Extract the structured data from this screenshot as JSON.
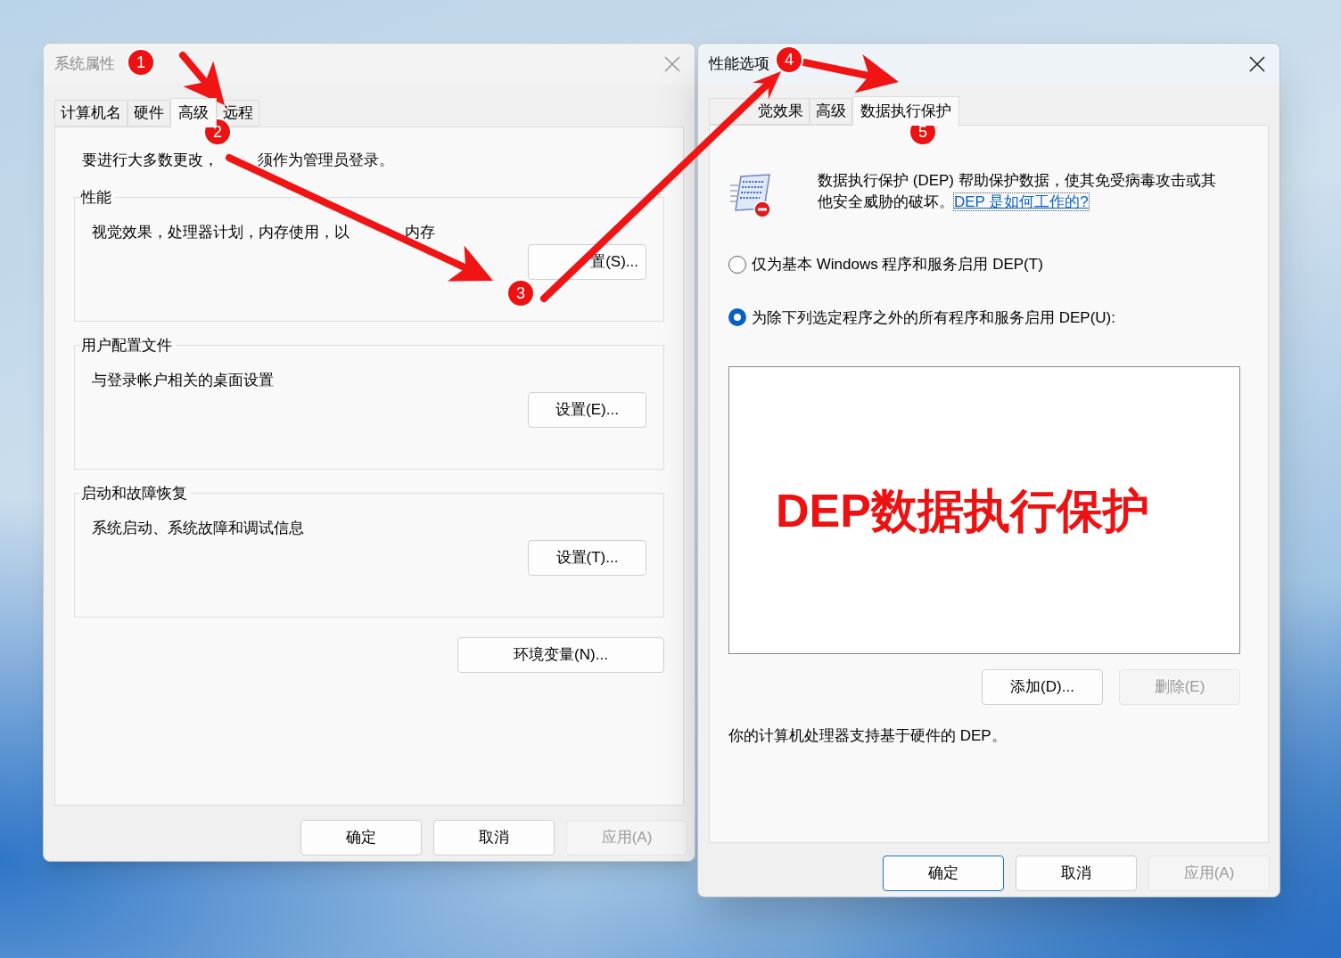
{
  "left_window": {
    "title": "系统属性",
    "active": false,
    "tabs": [
      {
        "label": "计算机名",
        "selected": false
      },
      {
        "label": "硬件",
        "selected": false
      },
      {
        "label": "高级",
        "selected": true
      },
      {
        "label": "远程",
        "selected": false
      }
    ],
    "notice": [
      "要进行大多数更改，",
      "须作为管理员登录。"
    ],
    "groups": [
      {
        "title": "性能",
        "description": [
          "视觉效果，处理器计划，内存使用，以",
          "内存"
        ],
        "button": "置(S)..."
      },
      {
        "title": "用户配置文件",
        "description": [
          "与登录帐户相关的桌面设置"
        ],
        "button": "设置(E)..."
      },
      {
        "title": "启动和故障恢复",
        "description": [
          "系统启动、系统故障和调试信息"
        ],
        "button": "设置(T)..."
      }
    ],
    "env_button": "环境变量(N)...",
    "buttons": [
      {
        "label": "确定",
        "default": false,
        "disabled": false
      },
      {
        "label": "取消",
        "default": false,
        "disabled": false
      },
      {
        "label": "应用(A)",
        "default": false,
        "disabled": true
      }
    ]
  },
  "right_window": {
    "title": "性能选项",
    "active": true,
    "tabs": [
      {
        "label": "觉效果",
        "selected": false
      },
      {
        "label": "高级",
        "selected": false
      },
      {
        "label": "数据执行保护",
        "selected": true
      }
    ],
    "description": "数据执行保护 (DEP) 帮助保护数据，使其免受病毒攻击或其他安全威胁的破坏。",
    "help_link": "DEP 是如何工作的?",
    "options": [
      {
        "label": "仅为基本 Windows 程序和服务启用 DEP(T)",
        "selected": false
      },
      {
        "label": "为除下列选定程序之外的所有程序和服务启用 DEP(U):",
        "selected": true
      }
    ],
    "list_annotation": "DEP数据执行保护",
    "list_buttons": [
      {
        "label": "添加(D)...",
        "disabled": false
      },
      {
        "label": "删除(E)",
        "disabled": true
      }
    ],
    "support_text": "你的计算机处理器支持基于硬件的 DEP。",
    "buttons": [
      {
        "label": "确定",
        "default": true,
        "disabled": false
      },
      {
        "label": "取消",
        "default": false,
        "disabled": false
      },
      {
        "label": "应用(A)",
        "default": false,
        "disabled": true
      }
    ]
  },
  "annotations": [
    {
      "number": "1"
    },
    {
      "number": "2"
    },
    {
      "number": "3"
    },
    {
      "number": "4"
    },
    {
      "number": "5"
    }
  ]
}
